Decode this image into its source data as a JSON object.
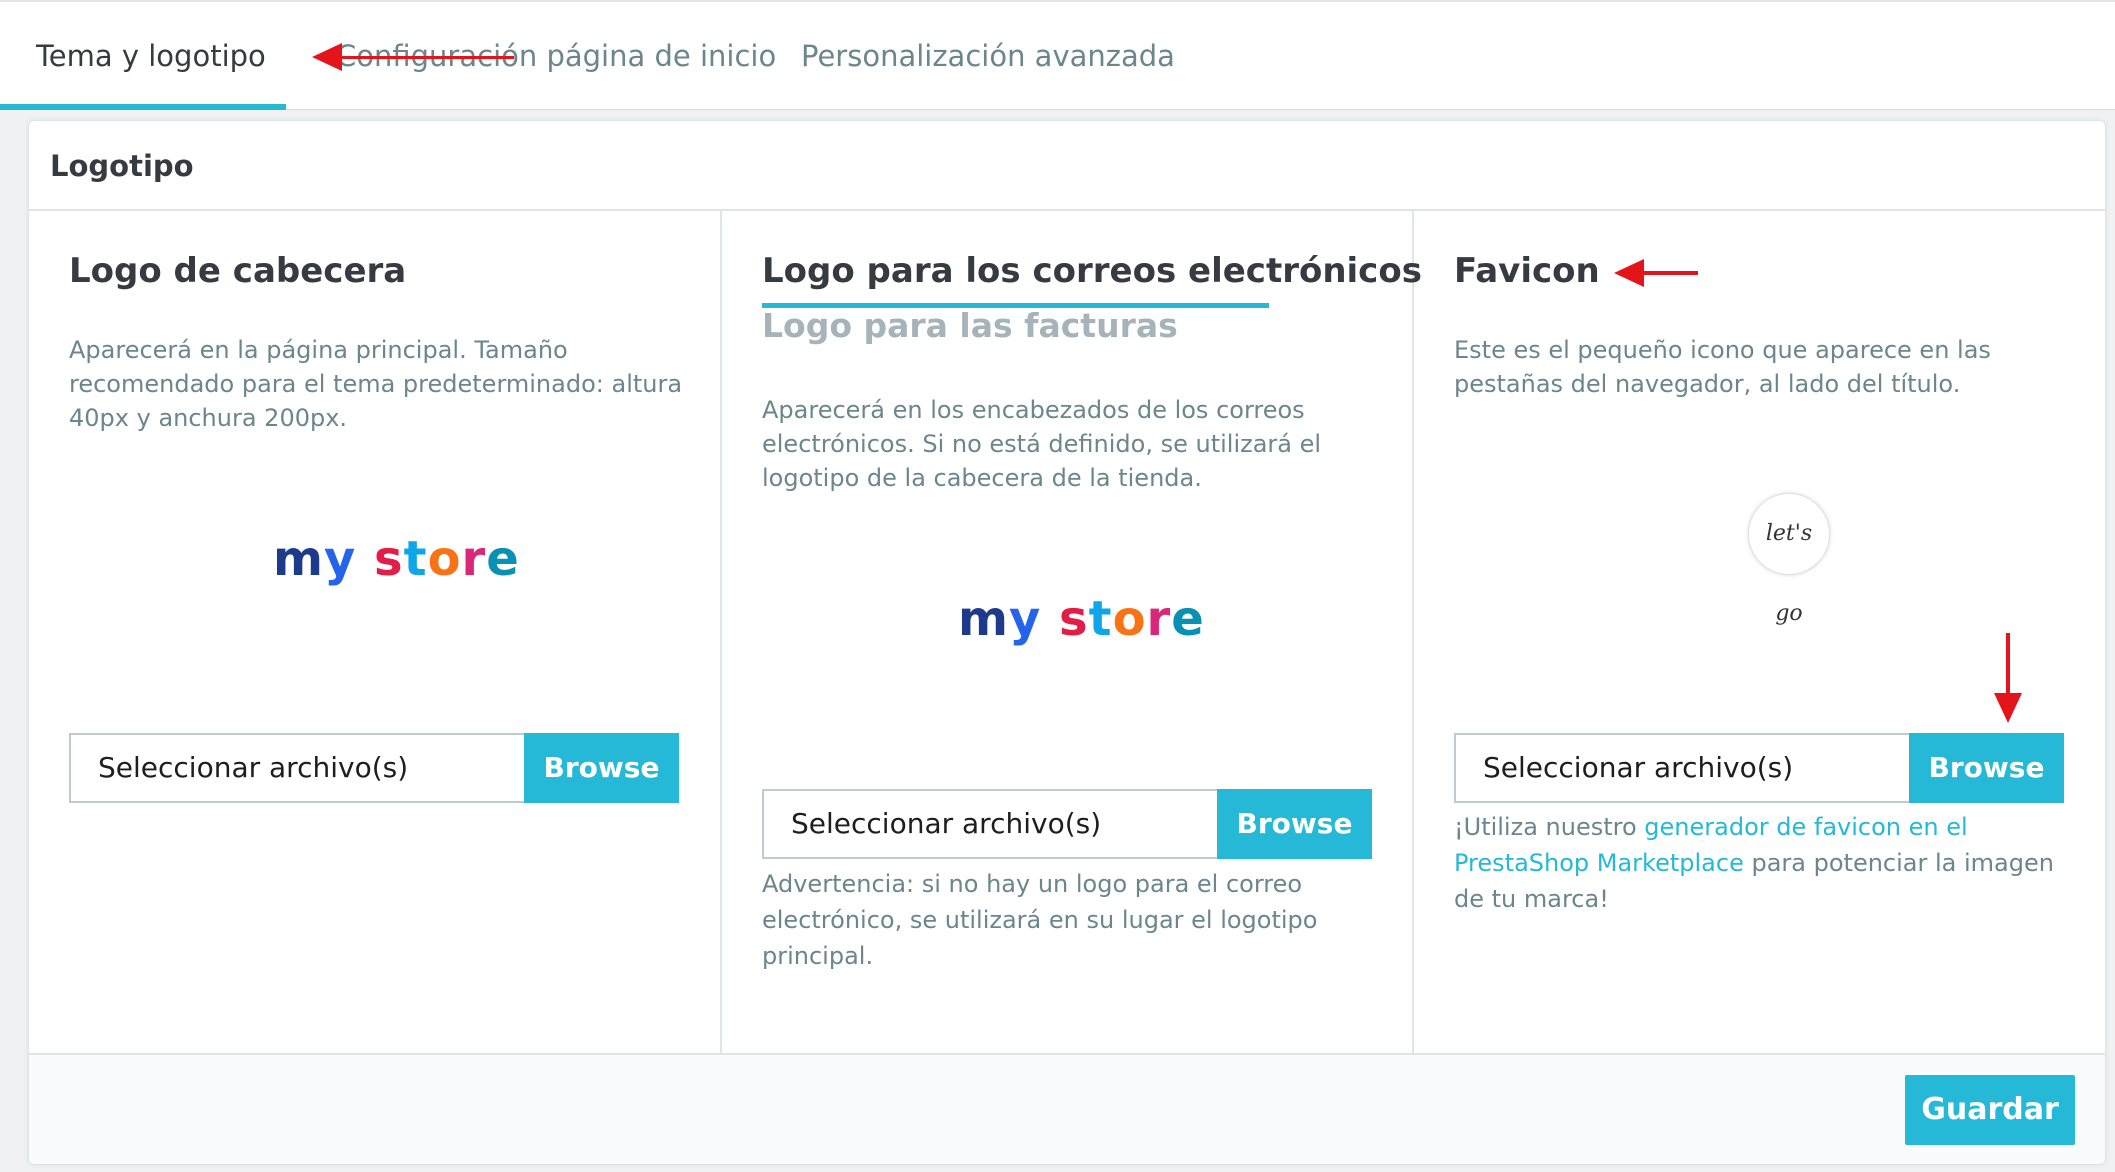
{
  "tabs": [
    {
      "label": "Tema y logotipo",
      "active": true
    },
    {
      "label": "Configuración página de inicio",
      "active": false
    },
    {
      "label": "Personalización avanzada",
      "active": false
    }
  ],
  "panel": {
    "title": "Logotipo",
    "columns": {
      "header_logo": {
        "title": "Logo de cabecera",
        "description": "Aparecerá en la página principal. Tamaño recomendado para el tema predeterminado: altura 40px y anchura 200px.",
        "logo_text": [
          "m",
          "y",
          " ",
          "s",
          "t",
          "o",
          "r",
          "e"
        ],
        "file_placeholder": "Seleccionar archivo(s)",
        "browse_label": "Browse"
      },
      "email_logo": {
        "title": "Logo para los correos electrónicos",
        "alt_tab": "Logo para las facturas",
        "description": "Aparecerá en los encabezados de los correos electrónicos. Si no está definido, se utilizará el logotipo de la cabecera de la tienda.",
        "file_placeholder": "Seleccionar archivo(s)",
        "browse_label": "Browse",
        "warning": "Advertencia: si no hay un logo para el correo electrónico, se utilizará en su lugar el logotipo principal."
      },
      "favicon": {
        "title": "Favicon",
        "description": "Este es el pequeño icono que aparece en las pestañas del navegador, al lado del título.",
        "favicon_text": "let's go",
        "file_placeholder": "Seleccionar archivo(s)",
        "browse_label": "Browse",
        "help_prefix": "¡Utiliza nuestro ",
        "help_link": "generador de favicon en el PrestaShop Marketplace",
        "help_suffix": " para potenciar la imagen de tu marca!"
      }
    },
    "save_label": "Guardar"
  },
  "colors": {
    "accent": "#25b9d7",
    "annotation": "#e3141a"
  }
}
